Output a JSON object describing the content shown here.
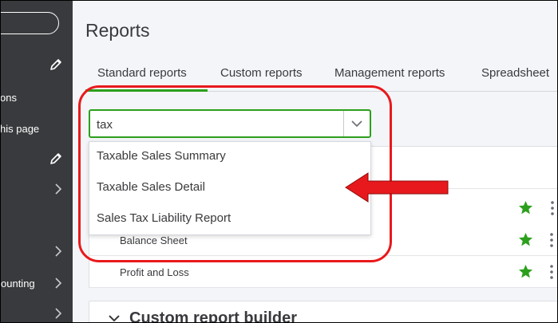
{
  "sidebar": {
    "text_1": "ons",
    "text_2": "his page",
    "text_3": "ounting"
  },
  "page": {
    "title": "Reports"
  },
  "tabs": [
    {
      "label": "Standard reports"
    },
    {
      "label": "Custom reports"
    },
    {
      "label": "Management reports"
    },
    {
      "label": "Spreadsheet"
    }
  ],
  "search": {
    "value": "tax"
  },
  "dropdown": {
    "items": [
      {
        "label": "Taxable Sales Summary"
      },
      {
        "label": "Taxable Sales Detail"
      },
      {
        "label": "Sales Tax Liability Report"
      }
    ]
  },
  "reports": [
    {
      "label": "Balance Sheet"
    },
    {
      "label": "Profit and Loss"
    }
  ],
  "section": {
    "title": "Custom report builder"
  },
  "colors": {
    "accent_green": "#2ca01c",
    "star_green": "#2ca01c",
    "annotation_red": "#e8191c",
    "sidebar_bg": "#393a3d"
  }
}
